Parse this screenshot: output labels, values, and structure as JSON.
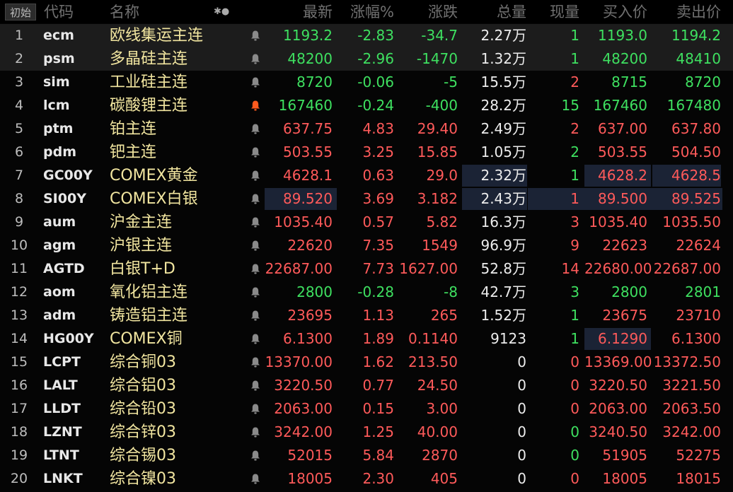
{
  "toolbar": {
    "reset_label": "初始"
  },
  "columns": {
    "code": "代码",
    "name": "名称",
    "indicator": "✱●",
    "last": "最新",
    "pct": "涨幅%",
    "change": "涨跌",
    "volume": "总量",
    "current": "现量",
    "bid": "买入价",
    "ask": "卖出价"
  },
  "colors": {
    "up": "#ff5a5a",
    "down": "#3ee060",
    "name": "#f2e6a0",
    "alert_on": "#ff5a1e"
  },
  "rows": [
    {
      "idx": "1",
      "code": "ecm",
      "name": "欧线集运主连",
      "last": "1193.2",
      "pct": "-2.83",
      "change": "-34.7",
      "vol": "2.27万",
      "cur": "1",
      "bid": "1193.0",
      "ask": "1194.2",
      "trend": "down",
      "cur_trend": "down",
      "bid_trend": "down",
      "ask_trend": "down",
      "alert": false
    },
    {
      "idx": "2",
      "code": "psm",
      "name": "多晶硅主连",
      "last": "48200",
      "pct": "-2.96",
      "change": "-1470",
      "vol": "1.32万",
      "cur": "1",
      "bid": "48200",
      "ask": "48410",
      "trend": "down",
      "cur_trend": "down",
      "bid_trend": "down",
      "ask_trend": "down",
      "alert": false
    },
    {
      "idx": "3",
      "code": "sim",
      "name": "工业硅主连",
      "last": "8720",
      "pct": "-0.06",
      "change": "-5",
      "vol": "15.5万",
      "cur": "2",
      "bid": "8715",
      "ask": "8720",
      "trend": "down",
      "cur_trend": "up",
      "bid_trend": "down",
      "ask_trend": "down",
      "alert": false
    },
    {
      "idx": "4",
      "code": "lcm",
      "name": "碳酸锂主连",
      "last": "167460",
      "pct": "-0.24",
      "change": "-400",
      "vol": "28.2万",
      "cur": "15",
      "bid": "167460",
      "ask": "167480",
      "trend": "down",
      "cur_trend": "down",
      "bid_trend": "down",
      "ask_trend": "down",
      "alert": true
    },
    {
      "idx": "5",
      "code": "ptm",
      "name": "铂主连",
      "last": "637.75",
      "pct": "4.83",
      "change": "29.40",
      "vol": "2.49万",
      "cur": "2",
      "bid": "637.00",
      "ask": "637.80",
      "trend": "up",
      "cur_trend": "up",
      "bid_trend": "up",
      "ask_trend": "up",
      "alert": false
    },
    {
      "idx": "6",
      "code": "pdm",
      "name": "钯主连",
      "last": "503.55",
      "pct": "3.25",
      "change": "15.85",
      "vol": "1.05万",
      "cur": "2",
      "bid": "503.55",
      "ask": "504.50",
      "trend": "up",
      "cur_trend": "down",
      "bid_trend": "up",
      "ask_trend": "up",
      "alert": false
    },
    {
      "idx": "7",
      "code": "GC00Y",
      "name": "COMEX黄金",
      "last": "4628.1",
      "pct": "0.63",
      "change": "29.0",
      "vol": "2.32万",
      "cur": "1",
      "bid": "4628.2",
      "ask": "4628.5",
      "trend": "up",
      "cur_trend": "down",
      "bid_trend": "up",
      "ask_trend": "up",
      "alert": false
    },
    {
      "idx": "8",
      "code": "SI00Y",
      "name": "COMEX白银",
      "last": "89.520",
      "pct": "3.69",
      "change": "3.182",
      "vol": "2.43万",
      "cur": "1",
      "bid": "89.500",
      "ask": "89.525",
      "trend": "up",
      "cur_trend": "up",
      "bid_trend": "up",
      "ask_trend": "up",
      "alert": false
    },
    {
      "idx": "9",
      "code": "aum",
      "name": "沪金主连",
      "last": "1035.40",
      "pct": "0.57",
      "change": "5.82",
      "vol": "16.3万",
      "cur": "3",
      "bid": "1035.40",
      "ask": "1035.50",
      "trend": "up",
      "cur_trend": "up",
      "bid_trend": "up",
      "ask_trend": "up",
      "alert": false
    },
    {
      "idx": "10",
      "code": "agm",
      "name": "沪银主连",
      "last": "22620",
      "pct": "7.35",
      "change": "1549",
      "vol": "96.9万",
      "cur": "9",
      "bid": "22623",
      "ask": "22624",
      "trend": "up",
      "cur_trend": "up",
      "bid_trend": "up",
      "ask_trend": "up",
      "alert": false
    },
    {
      "idx": "11",
      "code": "AGTD",
      "name": "白银T+D",
      "last": "22687.00",
      "pct": "7.73",
      "change": "1627.00",
      "vol": "52.8万",
      "cur": "14",
      "bid": "22680.00",
      "ask": "22687.00",
      "trend": "up",
      "cur_trend": "up",
      "bid_trend": "up",
      "ask_trend": "up",
      "alert": false
    },
    {
      "idx": "12",
      "code": "aom",
      "name": "氧化铝主连",
      "last": "2800",
      "pct": "-0.28",
      "change": "-8",
      "vol": "42.7万",
      "cur": "3",
      "bid": "2800",
      "ask": "2801",
      "trend": "down",
      "cur_trend": "down",
      "bid_trend": "down",
      "ask_trend": "down",
      "alert": false
    },
    {
      "idx": "13",
      "code": "adm",
      "name": "铸造铝主连",
      "last": "23695",
      "pct": "1.13",
      "change": "265",
      "vol": "1.52万",
      "cur": "1",
      "bid": "23675",
      "ask": "23710",
      "trend": "up",
      "cur_trend": "down",
      "bid_trend": "up",
      "ask_trend": "up",
      "alert": false
    },
    {
      "idx": "14",
      "code": "HG00Y",
      "name": "COMEX铜",
      "last": "6.1300",
      "pct": "1.89",
      "change": "0.1140",
      "vol": "9123",
      "cur": "1",
      "bid": "6.1290",
      "ask": "6.1300",
      "trend": "up",
      "cur_trend": "down",
      "bid_trend": "up",
      "ask_trend": "up",
      "alert": false
    },
    {
      "idx": "15",
      "code": "LCPT",
      "name": "综合铜03",
      "last": "13370.00",
      "pct": "1.62",
      "change": "213.50",
      "vol": "0",
      "cur": "0",
      "bid": "13369.00",
      "ask": "13372.50",
      "trend": "up",
      "cur_trend": "up",
      "bid_trend": "up",
      "ask_trend": "up",
      "alert": false
    },
    {
      "idx": "16",
      "code": "LALT",
      "name": "综合铝03",
      "last": "3220.50",
      "pct": "0.77",
      "change": "24.50",
      "vol": "0",
      "cur": "0",
      "bid": "3220.50",
      "ask": "3221.50",
      "trend": "up",
      "cur_trend": "up",
      "bid_trend": "up",
      "ask_trend": "up",
      "alert": false
    },
    {
      "idx": "17",
      "code": "LLDT",
      "name": "综合铅03",
      "last": "2063.00",
      "pct": "0.15",
      "change": "3.00",
      "vol": "0",
      "cur": "0",
      "bid": "2063.00",
      "ask": "2063.50",
      "trend": "up",
      "cur_trend": "up",
      "bid_trend": "up",
      "ask_trend": "up",
      "alert": false
    },
    {
      "idx": "18",
      "code": "LZNT",
      "name": "综合锌03",
      "last": "3242.00",
      "pct": "1.25",
      "change": "40.00",
      "vol": "0",
      "cur": "0",
      "bid": "3240.50",
      "ask": "3242.00",
      "trend": "up",
      "cur_trend": "down",
      "bid_trend": "up",
      "ask_trend": "up",
      "alert": false
    },
    {
      "idx": "19",
      "code": "LTNT",
      "name": "综合锡03",
      "last": "52015",
      "pct": "5.84",
      "change": "2870",
      "vol": "0",
      "cur": "0",
      "bid": "51905",
      "ask": "52275",
      "trend": "up",
      "cur_trend": "down",
      "bid_trend": "up",
      "ask_trend": "up",
      "alert": false
    },
    {
      "idx": "20",
      "code": "LNKT",
      "name": "综合镍03",
      "last": "18005",
      "pct": "2.30",
      "change": "405",
      "vol": "0",
      "cur": "0",
      "bid": "18005",
      "ask": "18015",
      "trend": "up",
      "cur_trend": "up",
      "bid_trend": "up",
      "ask_trend": "up",
      "alert": false
    }
  ]
}
